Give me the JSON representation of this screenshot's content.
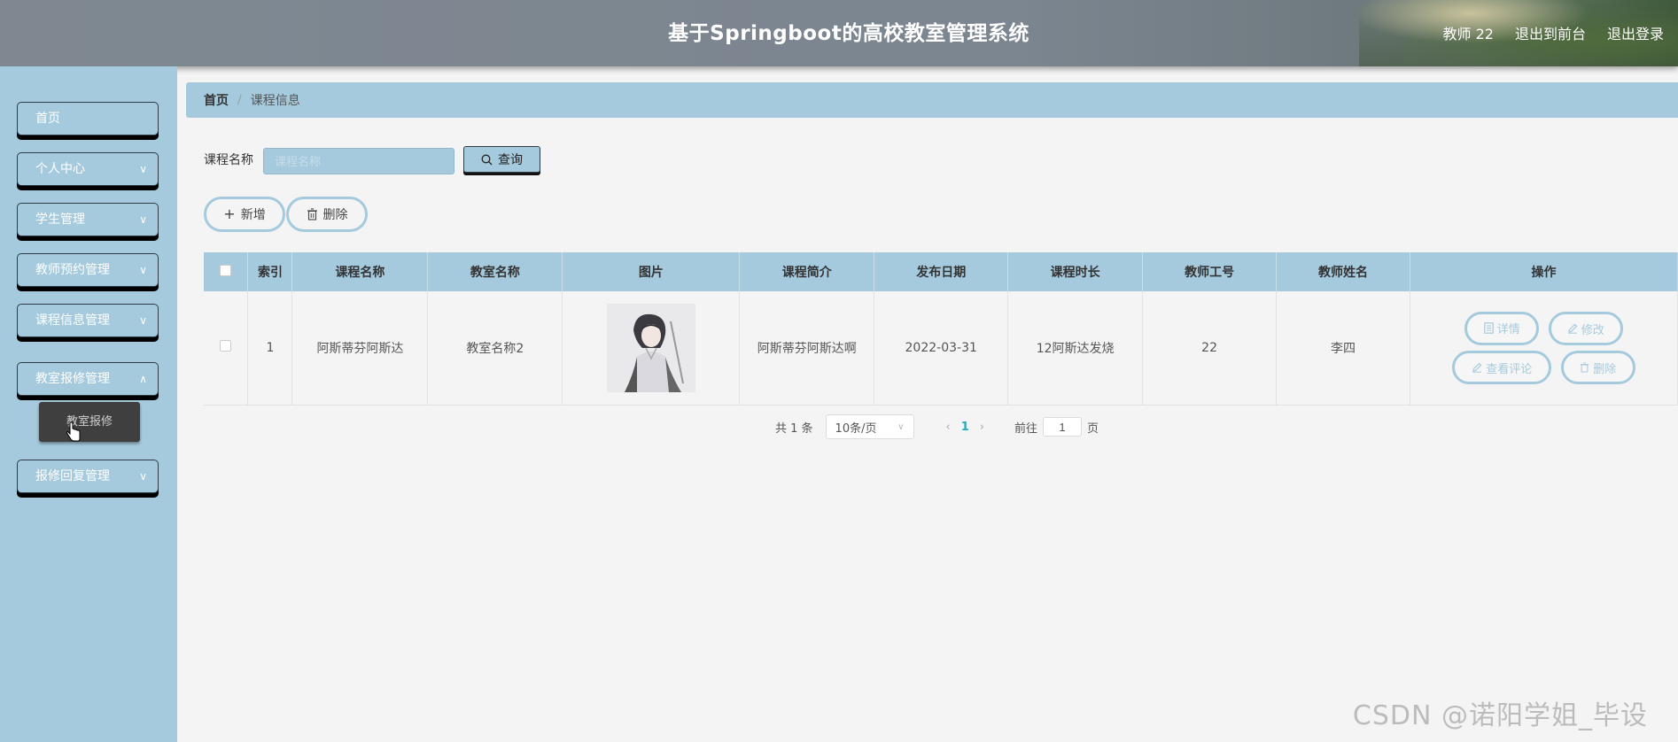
{
  "header": {
    "title": "基于Springboot的高校教室管理系统",
    "user": "教师 22",
    "front_link": "退出到前台",
    "logout": "退出登录"
  },
  "sidebar": {
    "items": [
      {
        "label": "首页",
        "has_arrow": false
      },
      {
        "label": "个人中心",
        "has_arrow": true
      },
      {
        "label": "学生管理",
        "has_arrow": true
      },
      {
        "label": "教师预约管理",
        "has_arrow": true
      },
      {
        "label": "课程信息管理",
        "has_arrow": true
      },
      {
        "label": "教室报修管理",
        "has_arrow": true
      },
      {
        "label": "报修回复管理",
        "has_arrow": true
      }
    ],
    "submenu": {
      "label": "教室报修"
    }
  },
  "breadcrumb": {
    "home": "首页",
    "current": "课程信息"
  },
  "search": {
    "label": "课程名称",
    "placeholder": "课程名称",
    "button": "查询"
  },
  "actions": {
    "add": "新增",
    "delete": "删除"
  },
  "table": {
    "headers": [
      "索引",
      "课程名称",
      "教室名称",
      "图片",
      "课程简介",
      "发布日期",
      "课程时长",
      "教师工号",
      "教师姓名",
      "操作"
    ],
    "rows": [
      {
        "index": "1",
        "course_name": "阿斯蒂芬阿斯达",
        "room_name": "教室名称2",
        "intro": "阿斯蒂芬阿斯达啊",
        "date": "2022-03-31",
        "duration": "12阿斯达发烧",
        "teacher_id": "22",
        "teacher_name": "李四"
      }
    ],
    "ops": {
      "detail": "详情",
      "edit": "修改",
      "comment": "查看评论",
      "delete": "删除"
    }
  },
  "pagination": {
    "total": "共 1 条",
    "page_size": "10条/页",
    "current": "1",
    "goto": "前往",
    "goto_value": "1",
    "page_suffix": "页"
  },
  "watermark": "CSDN @诺阳学姐_毕设",
  "colors": {
    "accent": "#a5cadd",
    "header": "#7f8891",
    "button_shadow": "#000000"
  }
}
